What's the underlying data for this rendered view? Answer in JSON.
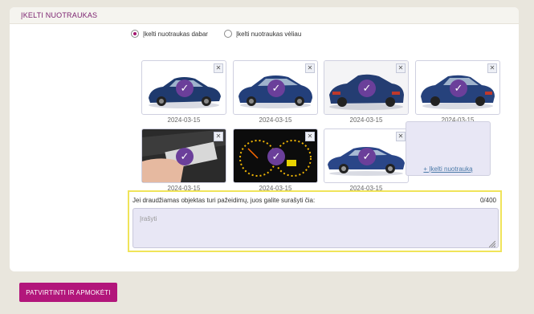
{
  "panel": {
    "title": "ĮKELTI NUOTRAUKAS"
  },
  "upload_mode": {
    "options": [
      {
        "label": "Įkelti nuotraukas dabar",
        "selected": true
      },
      {
        "label": "Įkelti nuotraukas vėliau",
        "selected": false
      }
    ]
  },
  "photos": [
    {
      "date": "2024-03-15",
      "subject": "car-front-left",
      "close": "✕",
      "check": "✓"
    },
    {
      "date": "2024-03-15",
      "subject": "car-front-right",
      "close": "✕",
      "check": "✓"
    },
    {
      "date": "2024-03-15",
      "subject": "car-rear-left",
      "close": "✕",
      "check": "✓"
    },
    {
      "date": "2024-03-15",
      "subject": "car-rear-right",
      "close": "✕",
      "check": "✓"
    },
    {
      "date": "2024-03-15",
      "subject": "vin-plate",
      "close": "✕",
      "check": "✓"
    },
    {
      "date": "2024-03-15",
      "subject": "dashboard",
      "close": "✕",
      "check": "✓"
    },
    {
      "date": "2024-03-15",
      "subject": "car-side",
      "close": "✕",
      "check": "✓"
    }
  ],
  "add_photo": {
    "label": "+ Įkelti nuotrauką"
  },
  "damage": {
    "label": "Jei draudžiamas objektas turi pažeidimų, juos galite surašyti čia:",
    "counter": "0/400",
    "placeholder": "Įrašyti"
  },
  "confirm_button": {
    "label": "PATVIRTINTI IR APMOKĖTI"
  },
  "colors": {
    "accent": "#b2167b",
    "title": "#7a1f6e",
    "check": "#6b3f9a",
    "highlight": "#f0e45a"
  }
}
